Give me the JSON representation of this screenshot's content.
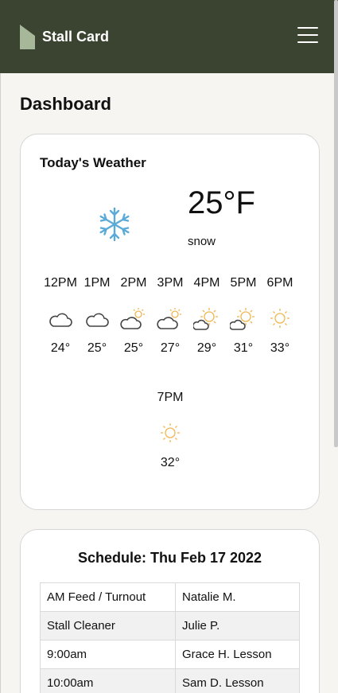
{
  "header": {
    "brand": "Stall Card",
    "menu_icon": "hamburger-menu-icon",
    "background": "#3b4331"
  },
  "page": {
    "title": "Dashboard"
  },
  "weather": {
    "title": "Today's Weather",
    "current_temp": "25°F",
    "condition": "snow",
    "current_icon": "snowflake-icon",
    "hourly": [
      {
        "time": "12PM",
        "icon": "cloud-icon",
        "temp": "24°"
      },
      {
        "time": "1PM",
        "icon": "cloud-icon",
        "temp": "25°"
      },
      {
        "time": "2PM",
        "icon": "partly-cloudy-icon",
        "temp": "25°"
      },
      {
        "time": "3PM",
        "icon": "partly-cloudy-icon",
        "temp": "27°"
      },
      {
        "time": "4PM",
        "icon": "partly-sunny-icon",
        "temp": "29°"
      },
      {
        "time": "5PM",
        "icon": "partly-sunny-icon",
        "temp": "31°"
      },
      {
        "time": "6PM",
        "icon": "sun-icon",
        "temp": "33°"
      },
      {
        "time": "7PM",
        "icon": "sun-icon",
        "temp": "32°"
      }
    ]
  },
  "schedule": {
    "title": "Schedule: Thu Feb 17 2022",
    "rows": [
      [
        "AM Feed / Turnout",
        "Natalie M."
      ],
      [
        "Stall Cleaner",
        "Julie P."
      ],
      [
        "9:00am",
        "Grace H. Lesson"
      ],
      [
        "10:00am",
        "Sam D. Lesson"
      ]
    ]
  }
}
